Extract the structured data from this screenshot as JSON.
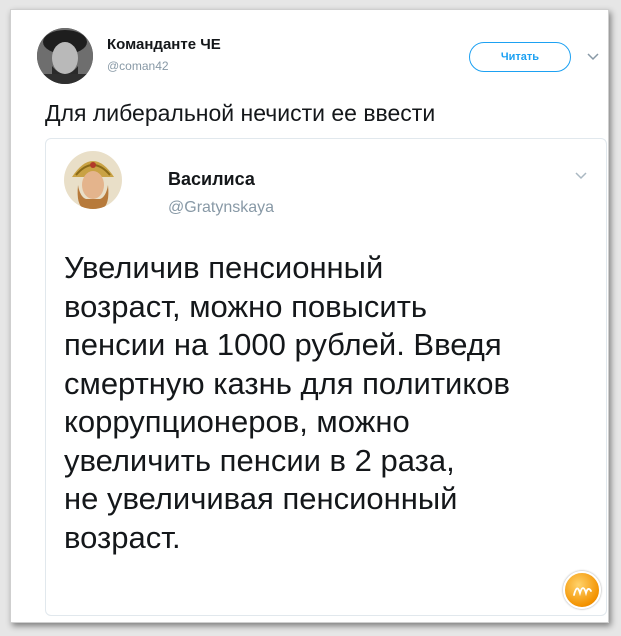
{
  "tweet": {
    "author": {
      "name": "Команданте ЧЕ",
      "handle": "@coman42"
    },
    "follow_label": "Читать",
    "text": "Для либеральной нечисти ее ввести"
  },
  "quoted": {
    "author": {
      "name": "Василиса",
      "handle": "@Gratynskaya"
    },
    "lines": [
      "Увеличив пенсионный",
      "возраст, можно повысить",
      "пенсии на 1000 рублей. Введя",
      "смертную казнь для политиков",
      "коррупционеров, можно",
      "увеличить пенсии в 2 раза,",
      "не увеличивая пенсионный",
      "возраст."
    ]
  },
  "icons": {
    "more": "chevron-down-icon",
    "watermark": "site-watermark-logo"
  },
  "colors": {
    "accent": "#1da1f2",
    "text": "#14171a",
    "muted": "#8899a6",
    "watermark": "#f39200"
  }
}
